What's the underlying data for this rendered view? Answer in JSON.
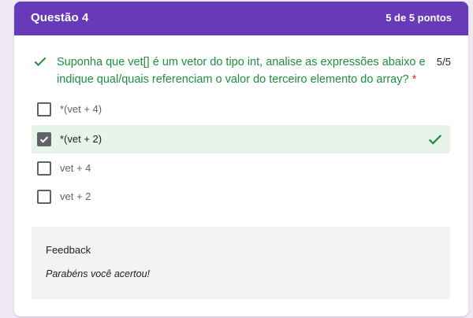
{
  "header": {
    "title": "Questão 4",
    "score": "5 de 5 pontos",
    "color": "#673ab7"
  },
  "question": {
    "status_icon": "check-icon",
    "text": "Suponha que vet[] é um vetor do tipo int, analise as expressões abaixo e indique qual/quais referenciam o valor do terceiro elemento do array?",
    "required_mark": "*",
    "points": "5/5",
    "correct_color": "#1e8e3e"
  },
  "options": [
    {
      "label": "*(vet + 4)",
      "checked": false,
      "correct": false
    },
    {
      "label": "*(vet + 2)",
      "checked": true,
      "correct": true
    },
    {
      "label": "vet + 4",
      "checked": false,
      "correct": false
    },
    {
      "label": "vet + 2",
      "checked": false,
      "correct": false
    }
  ],
  "feedback": {
    "title": "Feedback",
    "text": "Parabéns você acertou!"
  }
}
